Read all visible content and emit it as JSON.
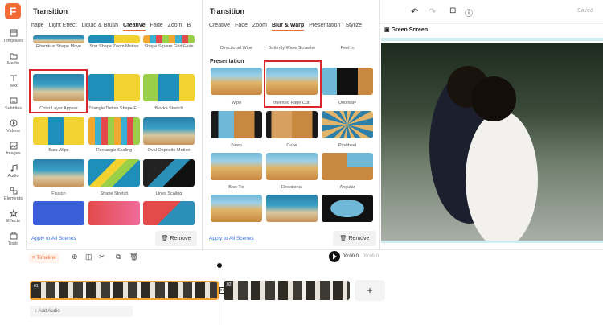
{
  "app": {
    "logo_text": "F",
    "brand_color": "#f26a35"
  },
  "rail": [
    {
      "label": "Templates",
      "icon": "templates-icon"
    },
    {
      "label": "Media",
      "icon": "folder-icon"
    },
    {
      "label": "Text",
      "icon": "text-icon"
    },
    {
      "label": "Subtitles",
      "icon": "subtitles-icon"
    },
    {
      "label": "Videos",
      "icon": "video-icon"
    },
    {
      "label": "Images",
      "icon": "image-icon"
    },
    {
      "label": "Audio",
      "icon": "music-icon"
    },
    {
      "label": "Elements",
      "icon": "shapes-icon"
    },
    {
      "label": "Effects",
      "icon": "effects-icon"
    },
    {
      "label": "Tools",
      "icon": "toolbox-icon"
    }
  ],
  "left_panel": {
    "title": "Transition",
    "tabs": [
      "hape",
      "Light Effect",
      "Liquid & Brush",
      "Creative",
      "Fade",
      "Zoom",
      "B"
    ],
    "active_tab": "Creative",
    "items": [
      "Rhombus Shape Move",
      "Star Shape Zoom Motion",
      "Shape Square Grid Fade",
      "Color Layer Appear",
      "Triangle Debris Shape F...",
      "Blocks Stretch",
      "Bars Wipe",
      "Rectangle Scaling",
      "Oval Opposite Motion",
      "Fission",
      "Shape Stretch",
      "Lines Scaling"
    ],
    "apply_all": "Apply to All Scenes",
    "remove": "Remove"
  },
  "right_panel": {
    "title": "Transition",
    "tabs": [
      "Creative",
      "Fade",
      "Zoom",
      "Blur & Warp",
      "Presentation",
      "Stylize"
    ],
    "active_tab": "Blur & Warp",
    "top_items": [
      "Directional Wipe",
      "Butterfly Wave Scrawler",
      "Peel In"
    ],
    "section": "Presentation",
    "items": [
      "Wipe",
      "Inverted Page Curl",
      "Doorway",
      "Swap",
      "Cube",
      "Pinwheel",
      "Bow Tie",
      "Directional",
      "Angular"
    ],
    "apply_all": "Apply to All Scenes",
    "remove": "Remove"
  },
  "topbar": {
    "saved": "Saved"
  },
  "preview": {
    "green_screen": "Green Screen"
  },
  "timeline": {
    "label": "Timeline",
    "time_current": "00:00.0",
    "time_total": "00:05.0",
    "clip1_badge": "01",
    "clip2_badge": "02",
    "add_audio": "Add Audio",
    "add_symbol": "+"
  }
}
